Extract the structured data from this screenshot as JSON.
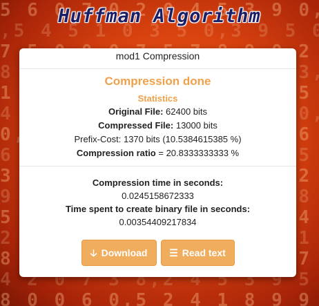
{
  "header": {
    "logo_text": "Huffman Algorithm"
  },
  "background": {
    "digit_rows": [
      "5 6 0 7 0,2 0 4 5 3 9 0,0",
      ",5 4 5 1 0 3 5 0,3 9 5 0,",
      "7 5 0 0,0 7 5 7 8 9 0 2 1",
      "8 9 0 0,8 0 5 4 2 7 9 3,0",
      "1 2 6 8,5 4 0 1 3 0,0 5 7",
      "4 3,9 2 1 5 6 0 8 9 2 0,1",
      "0,7 8 5 4 3 2 1 0 9,5 6 0",
      "6 5 4 1,0 2 3 9 8 7 6,5 4",
      "3 2 1 0,9 8 7 6 5 4,3 2 1",
      "9 8,7 6 5 4 3 2 1 0,9 8 7",
      "5 4 3 2,1 0 9 8 7,6 5 4 3",
      "2 1 0 9 8 7,6 5 4 3 2 1 0",
      "8 7 6 5 4,3 2 1 0 9 8 7 6",
      "4 2 0 7 3 8,2 4 5 3 9 5 7 2,0",
      "8 0 0 6 0,5 2 4 1 8 9 9 9,0"
    ]
  },
  "modal": {
    "title": "mod1 Compression",
    "done_title": "Compression done",
    "stats_title": "Statistics",
    "original_label": "Original File:",
    "original_value": " 62400 bits",
    "compressed_label": "Compressed File:",
    "compressed_value": " 13000 bits",
    "prefix_cost": "Prefix-Cost: 1370 bits (10.5384615385 %)",
    "ratio_label": "Compression ratio",
    "ratio_value": " = 20.8333333333 %",
    "time_label": "Compression time in seconds:",
    "time_value": "0.0245158672333",
    "binary_time_label": "Time spent to create binary file in seconds:",
    "binary_time_value": "0.00354409217834",
    "download_label": "Download",
    "read_label": "Read text"
  },
  "colors": {
    "accent_orange": "#f0a14a",
    "button_orange": "#f0ad5e",
    "logo_navy": "#1c1f66"
  },
  "icons": {
    "download": "download-arrow-icon",
    "read": "list-lines-icon"
  }
}
